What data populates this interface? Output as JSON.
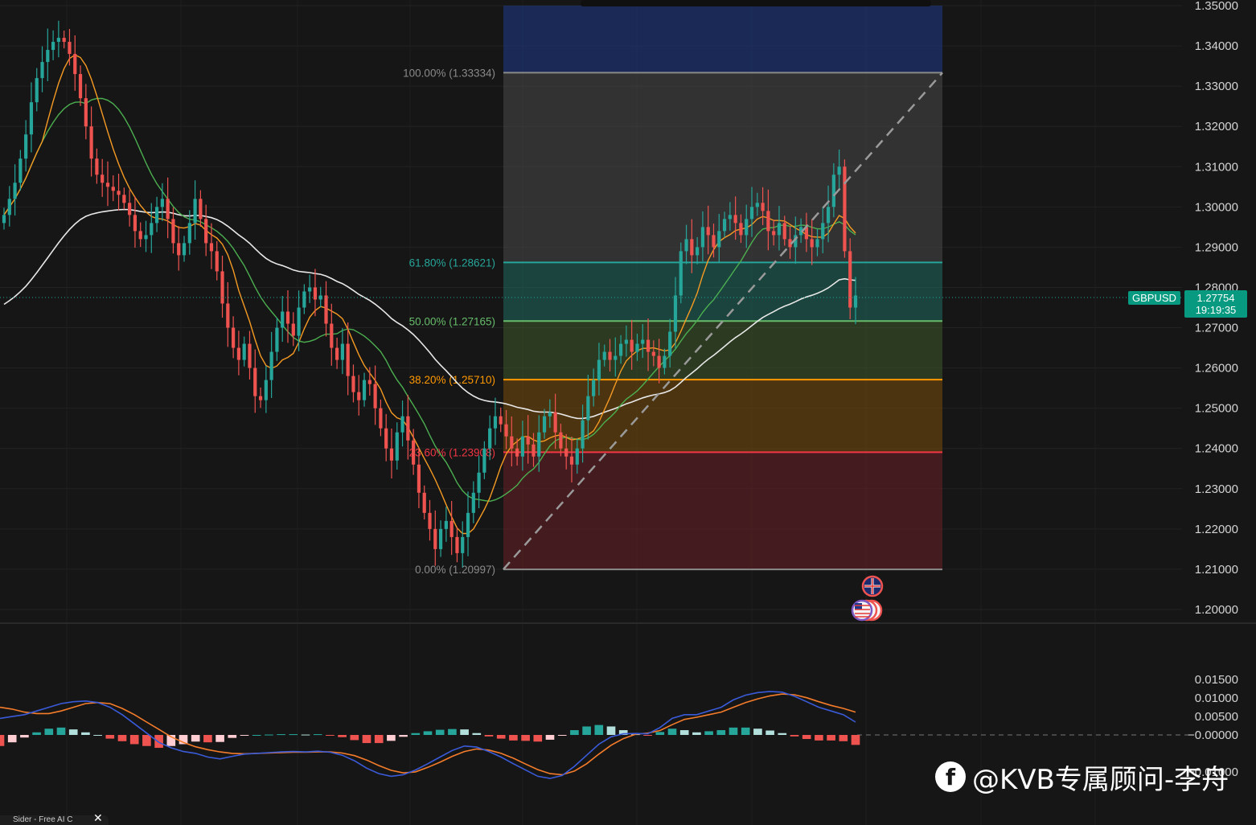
{
  "symbol": "GBPUSD",
  "last_price": "1.27754",
  "countdown": "19:19:35",
  "watermark": "@KVB专属顾问-李舟",
  "watermark_logo": "f",
  "bottom_tag": "Sider - Free AI C",
  "bottom_close": "✕",
  "colors": {
    "background": "#161616",
    "up": "#26a69a",
    "down": "#ef5350",
    "ma_fast": "#f59a23",
    "ma_mid": "#4caf50",
    "ma_slow": "#e8e8e8",
    "macd": "#3a5bd9",
    "signal": "#f57c2a",
    "hist_up_strong": "#26a69a",
    "hist_up_weak": "#b2dfdb",
    "hist_down_strong": "#ef5350",
    "hist_down_weak": "#ffcdd2"
  },
  "chart_data": [
    {
      "type": "candlestick",
      "symbol": "GBPUSD",
      "y_axis": {
        "ticks": [
          "1.35000",
          "1.34000",
          "1.33000",
          "1.32000",
          "1.31000",
          "1.30000",
          "1.29000",
          "1.28000",
          "1.27000",
          "1.26000",
          "1.25000",
          "1.24000",
          "1.23000",
          "1.22000",
          "1.21000",
          "1.20000"
        ],
        "range": [
          1.2,
          1.35
        ]
      },
      "last_price": 1.27754,
      "close_path": [
        1.298,
        1.302,
        1.306,
        1.312,
        1.318,
        1.326,
        1.332,
        1.336,
        1.339,
        1.341,
        1.342,
        1.341,
        1.338,
        1.333,
        1.327,
        1.32,
        1.312,
        1.308,
        1.306,
        1.305,
        1.304,
        1.303,
        1.301,
        1.298,
        1.294,
        1.292,
        1.293,
        1.296,
        1.3,
        1.302,
        1.297,
        1.291,
        1.288,
        1.291,
        1.296,
        1.302,
        1.297,
        1.291,
        1.289,
        1.284,
        1.276,
        1.27,
        1.265,
        1.262,
        1.266,
        1.26,
        1.253,
        1.252,
        1.257,
        1.264,
        1.27,
        1.274,
        1.271,
        1.268,
        1.275,
        1.279,
        1.28,
        1.277,
        1.278,
        1.271,
        1.265,
        1.262,
        1.266,
        1.258,
        1.254,
        1.252,
        1.257,
        1.256,
        1.25,
        1.245,
        1.24,
        1.237,
        1.244,
        1.248,
        1.242,
        1.236,
        1.229,
        1.224,
        1.22,
        1.215,
        1.22,
        1.222,
        1.218,
        1.214,
        1.218,
        1.224,
        1.229,
        1.234,
        1.24,
        1.245,
        1.248,
        1.246,
        1.243,
        1.24,
        1.238,
        1.243,
        1.241,
        1.238,
        1.244,
        1.248,
        1.249,
        1.244,
        1.24,
        1.238,
        1.236,
        1.24,
        1.247,
        1.253,
        1.257,
        1.262,
        1.264,
        1.262,
        1.263,
        1.266,
        1.267,
        1.264,
        1.266,
        1.267,
        1.264,
        1.263,
        1.26,
        1.263,
        1.269,
        1.278,
        1.289,
        1.292,
        1.288,
        1.29,
        1.295,
        1.293,
        1.29,
        1.294,
        1.297,
        1.298,
        1.296,
        1.293,
        1.297,
        1.3,
        1.301,
        1.299,
        1.294,
        1.293,
        1.296,
        1.292,
        1.29,
        1.293,
        1.295,
        1.292,
        1.29,
        1.292,
        1.296,
        1.3,
        1.308,
        1.31,
        1.289,
        1.275,
        1.278
      ],
      "moving_averages": [
        {
          "name": "MA fast",
          "color": "#f59a23"
        },
        {
          "name": "MA mid",
          "color": "#4caf50"
        },
        {
          "name": "MA slow",
          "color": "#e8e8e8"
        }
      ],
      "fibonacci": {
        "levels": [
          {
            "label": "100.00% (1.33334)",
            "value": 1.33334,
            "color": "#8a8a8a"
          },
          {
            "label": "61.80% (1.28621)",
            "value": 1.28621,
            "color": "#26a69a"
          },
          {
            "label": "50.00% (1.27165)",
            "value": 1.27165,
            "color": "#66bb6a"
          },
          {
            "label": "38.20% (1.25710)",
            "value": 1.2571,
            "color": "#ff9800"
          },
          {
            "label": "23.60% (1.23908)",
            "value": 1.23908,
            "color": "#f23645"
          },
          {
            "label": "0.00% (1.20997)",
            "value": 1.20997,
            "color": "#8a8a8a"
          }
        ],
        "zones": [
          {
            "from": 1.33334,
            "to": 1.35,
            "color": "#1f3a8a"
          },
          {
            "from": 1.28621,
            "to": 1.33334,
            "color": "#4a4a4a"
          },
          {
            "from": 1.27165,
            "to": 1.28621,
            "color": "#1f6b5e"
          },
          {
            "from": 1.2571,
            "to": 1.27165,
            "color": "#3e5a2a"
          },
          {
            "from": 1.23908,
            "to": 1.2571,
            "color": "#7a4e0d"
          },
          {
            "from": 1.20997,
            "to": 1.23908,
            "color": "#6b2026"
          }
        ],
        "trend_line": {
          "from": 1.20997,
          "to": 1.33334,
          "style": "dashed"
        }
      },
      "events": [
        "GB flag",
        "US flag"
      ]
    },
    {
      "type": "macd",
      "y_axis": {
        "ticks": [
          "0.01500",
          "0.01000",
          "0.00500",
          "−0.00000",
          "−0.01000"
        ],
        "range": [
          -0.012,
          0.016
        ]
      },
      "macd_line": [
        0.0045,
        0.005,
        0.0055,
        0.0065,
        0.0075,
        0.0085,
        0.009,
        0.0092,
        0.0088,
        0.0075,
        0.0055,
        0.003,
        0.0005,
        -0.002,
        -0.0035,
        -0.0045,
        -0.005,
        -0.006,
        -0.0065,
        -0.0058,
        -0.0052,
        -0.005,
        -0.0048,
        -0.0046,
        -0.0045,
        -0.0046,
        -0.0044,
        -0.0047,
        -0.0055,
        -0.007,
        -0.009,
        -0.0105,
        -0.0112,
        -0.0108,
        -0.0095,
        -0.0078,
        -0.006,
        -0.0042,
        -0.003,
        -0.0033,
        -0.0045,
        -0.006,
        -0.0078,
        -0.0095,
        -0.0112,
        -0.0118,
        -0.011,
        -0.0085,
        -0.0055,
        -0.0025,
        -0.0005,
        0.0003,
        0.0004,
        0.0003,
        0.002,
        0.0045,
        0.0055,
        0.0055,
        0.0065,
        0.0075,
        0.0095,
        0.0108,
        0.0115,
        0.0118,
        0.0116,
        0.0105,
        0.009,
        0.0075,
        0.0065,
        0.0055,
        0.0035
      ],
      "signal_line": [
        0.0075,
        0.007,
        0.0062,
        0.0058,
        0.0058,
        0.0065,
        0.0075,
        0.0085,
        0.0088,
        0.0085,
        0.0072,
        0.0055,
        0.0035,
        0.0015,
        -0.0005,
        -0.002,
        -0.0032,
        -0.004,
        -0.0046,
        -0.005,
        -0.0051,
        -0.005,
        -0.0049,
        -0.0048,
        -0.0047,
        -0.0047,
        -0.0046,
        -0.0046,
        -0.0049,
        -0.0056,
        -0.0068,
        -0.0083,
        -0.0096,
        -0.0103,
        -0.01,
        -0.0088,
        -0.0074,
        -0.0058,
        -0.0045,
        -0.0038,
        -0.0041,
        -0.005,
        -0.0063,
        -0.0079,
        -0.0094,
        -0.0105,
        -0.0108,
        -0.0098,
        -0.0078,
        -0.0052,
        -0.0028,
        -0.001,
        0.0002,
        0.0005,
        0.0012,
        0.0028,
        0.0042,
        0.0048,
        0.0055,
        0.0062,
        0.0075,
        0.0088,
        0.0098,
        0.0106,
        0.0111,
        0.0109,
        0.0101,
        0.009,
        0.008,
        0.0072,
        0.0062
      ]
    }
  ]
}
